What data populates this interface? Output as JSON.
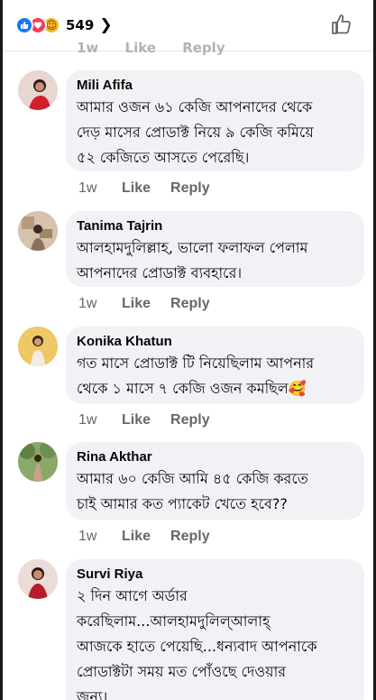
{
  "header": {
    "reaction_count": "549",
    "ghost_time": "1w",
    "ghost_like": "Like",
    "ghost_reply": "Reply"
  },
  "comments": [
    {
      "name": "Mili Afifa",
      "lines": [
        "আমার ওজন ৬১ কেজি আপনাদের থেকে",
        "দেড় মাসের প্রোডাক্ট নিয়ে ৯ কেজি কমিয়ে",
        "৫২ কেজিতে আসতে পেরেছি।"
      ],
      "time": "1w",
      "like": "Like",
      "reply": "Reply"
    },
    {
      "name": "Tanima Tajrin",
      "lines": [
        "আলহামদুলিল্লাহ,  ভালো ফলাফল পেলাম",
        "আপনাদের প্রোডাক্ট ব্যবহারে।"
      ],
      "time": "1w",
      "like": "Like",
      "reply": "Reply"
    },
    {
      "name": "Konika Khatun",
      "lines": [
        "গত মাসে প্রোডাক্ট টি নিয়েছিলাম আপনার",
        "থেকে ১ মাসে ৭ কেজি ওজন কমছিল🥰"
      ],
      "time": "1w",
      "like": "Like",
      "reply": "Reply"
    },
    {
      "name": "Rina Akthar",
      "lines": [
        "আমার ৬০ কেজি আমি ৪৫ কেজি করতে",
        "চাই আমার কত প্যাকেট খেতে হবে??"
      ],
      "time": "1w",
      "like": "Like",
      "reply": "Reply"
    },
    {
      "name": "Survi Riya",
      "lines": [
        "২ দিন আগে অর্ডার",
        "করেছিলাম...আলহামদুলিল্আলাহ্",
        "আজকে হাতে পেয়েছি...ধন্যবাদ আপনাকে",
        "প্রোডাক্টটা সময় মত পোঁওছে দেওয়ার",
        "জন্য।"
      ]
    }
  ],
  "colors": {
    "bubble": "#f0f2f5",
    "like_blue": "#1877f2",
    "love_red": "#f33e58",
    "meta_gray": "#65676b"
  }
}
